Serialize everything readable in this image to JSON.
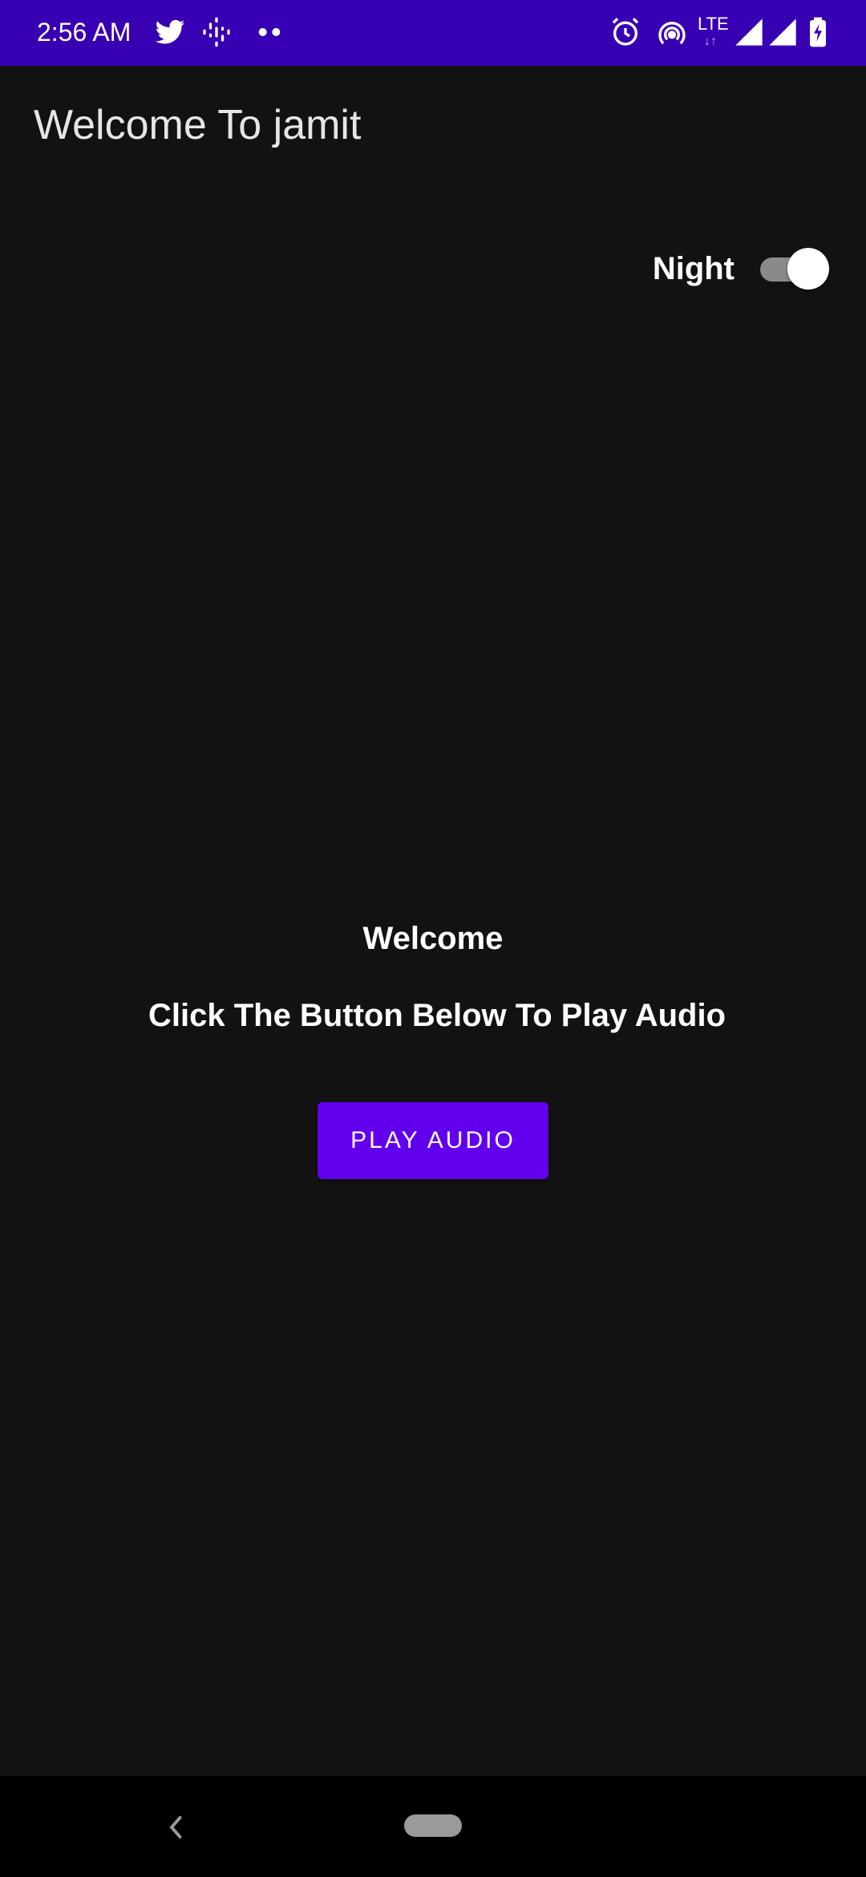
{
  "status_bar": {
    "time": "2:56 AM",
    "network_label": "LTE",
    "background_color": "#3700b3",
    "icons": [
      "twitter-icon",
      "podcasts-icon",
      "more-notifications-icon",
      "alarm-icon",
      "hotspot-icon",
      "lte-icon",
      "signal-icon",
      "signal-icon",
      "battery-charging-icon"
    ]
  },
  "app_bar": {
    "title": "Welcome To jamit"
  },
  "theme_toggle": {
    "label": "Night",
    "checked": true
  },
  "main": {
    "heading": "Welcome",
    "instruction": "Click The Button Below To Play Audio",
    "play_button_label": "PLAY AUDIO",
    "accent_color": "#6200ee"
  },
  "nav_bar": {
    "icons": [
      "back-icon",
      "home-pill-icon"
    ]
  }
}
